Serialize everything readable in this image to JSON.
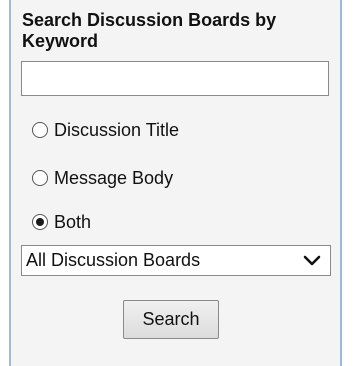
{
  "search_panel": {
    "title": "Search Discussion Boards by Keyword",
    "keyword": {
      "value": "",
      "placeholder": ""
    },
    "options": [
      {
        "label": "Discussion Title",
        "selected": false
      },
      {
        "label": "Message Body",
        "selected": false
      },
      {
        "label": "Both",
        "selected": true
      }
    ],
    "board_select": {
      "selected": "All Discussion Boards"
    },
    "search_button_label": "Search"
  },
  "colors": {
    "panel_border": "#9dbad6",
    "panel_background": "#f4f4f4"
  },
  "icons": {
    "select_arrow": "chevron-down-icon"
  }
}
